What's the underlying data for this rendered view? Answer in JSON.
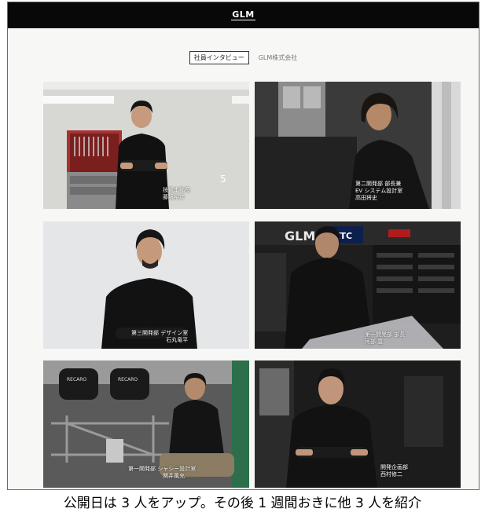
{
  "header": {
    "logo_text": "GLM"
  },
  "nav": {
    "active_tab": "社員インタビュー",
    "company_link": "GLM株式会社"
  },
  "interviews": [
    {
      "caption": [
        "技術本部長",
        "藤墳裕次"
      ]
    },
    {
      "caption": [
        "第二開発部 部長兼",
        "EV システム設計室",
        "高田将史"
      ]
    },
    {
      "caption": [
        "第三開発部 デザイン室",
        "石丸竜平"
      ]
    },
    {
      "caption": [
        "第一開発部 部長",
        "阿部 豊"
      ]
    },
    {
      "caption": [
        "第一開発部 シャシー設計室",
        "関井風允"
      ]
    },
    {
      "caption": [
        "開発企画部",
        "西村修二"
      ]
    }
  ],
  "footer_caption": "公開日は 3 人をアップ。その後 1 週間おきに他 3 人を紹介",
  "colors": {
    "header_bg": "#080808",
    "page_bg": "#f7f7f5"
  }
}
